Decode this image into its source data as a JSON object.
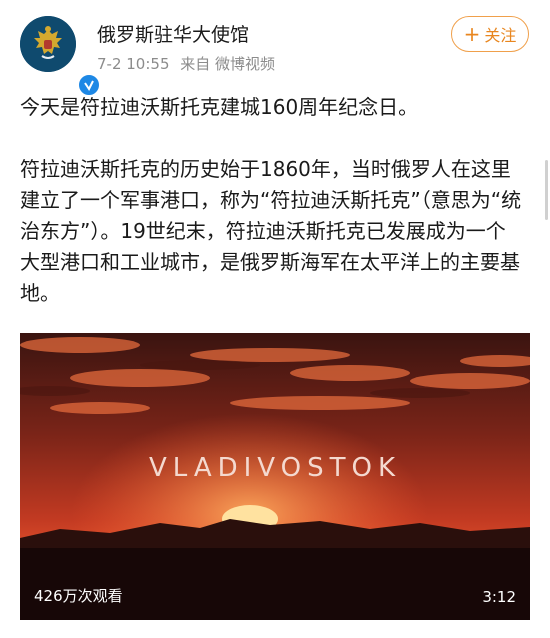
{
  "account": {
    "name": "俄罗斯驻华大使馆",
    "time": "7-2 10:55",
    "source": "来自 微博视频"
  },
  "follow_button": {
    "label": "关注",
    "icon": "plus-icon"
  },
  "post": {
    "paragraph1": "今天是符拉迪沃斯托克建城160周年纪念日。",
    "paragraph2": "符拉迪沃斯托克的历史始于1860年，当时俄罗人在这里建立了一个军事港口，称为“符拉迪沃斯托克”（意思为“统治东方”）。19世纪末，符拉迪沃斯托克已发展成为一个大型港口和工业城市，是俄罗斯海军在太平洋上的主要基地。"
  },
  "video": {
    "title": "VLADIVOSTOK",
    "views": "426万次观看",
    "duration": "3:12"
  },
  "colors": {
    "follow": "#e8861f",
    "verified": "#1e88e5"
  }
}
